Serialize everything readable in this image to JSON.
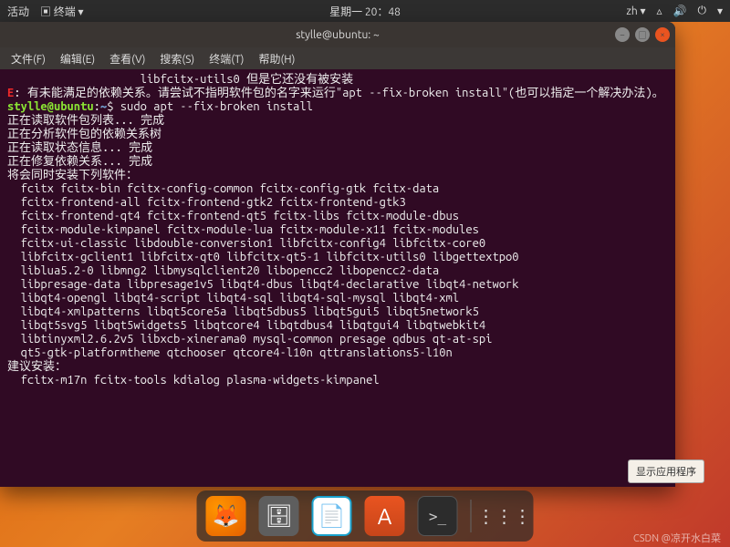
{
  "topbar": {
    "activities": "活动",
    "app": "终端",
    "datetime": "星期一  20：48",
    "lang": "zh"
  },
  "window": {
    "title": "stylle@ubuntu: ~"
  },
  "menubar": {
    "file": "文件(F)",
    "edit": "编辑(E)",
    "view": "查看(V)",
    "search": "搜索(S)",
    "terminal": "终端(T)",
    "help": "帮助(H)"
  },
  "terminal": {
    "l0": "                    libfcitx-utils0 但是它还没有被安装",
    "l1a": "E",
    "l1b": ": 有未能满足的依赖关系。请尝试不指明软件包的名字来运行\"apt --fix-broken install\"(也可以指定一个解决办法)。",
    "prompt_user": "stylle@ubuntu",
    "prompt_path": "~",
    "prompt_sep": ":",
    "prompt_dollar": "$ ",
    "cmd": "sudo apt --fix-broken install",
    "l3": "正在读取软件包列表... 完成",
    "l4": "正在分析软件包的依赖关系树",
    "l5": "正在读取状态信息... 完成",
    "l6": "正在修复依赖关系... 完成",
    "l7": "将会同时安装下列软件：",
    "p0": "  fcitx fcitx-bin fcitx-config-common fcitx-config-gtk fcitx-data",
    "p1": "  fcitx-frontend-all fcitx-frontend-gtk2 fcitx-frontend-gtk3",
    "p2": "  fcitx-frontend-qt4 fcitx-frontend-qt5 fcitx-libs fcitx-module-dbus",
    "p3": "  fcitx-module-kimpanel fcitx-module-lua fcitx-module-x11 fcitx-modules",
    "p4": "  fcitx-ui-classic libdouble-conversion1 libfcitx-config4 libfcitx-core0",
    "p5": "  libfcitx-gclient1 libfcitx-qt0 libfcitx-qt5-1 libfcitx-utils0 libgettextpo0",
    "p6": "  liblua5.2-0 libmng2 libmysqlclient20 libopencc2 libopencc2-data",
    "p7": "  libpresage-data libpresage1v5 libqt4-dbus libqt4-declarative libqt4-network",
    "p8": "  libqt4-opengl libqt4-script libqt4-sql libqt4-sql-mysql libqt4-xml",
    "p9": "  libqt4-xmlpatterns libqt5core5a libqt5dbus5 libqt5gui5 libqt5network5",
    "p10": "  libqt5svg5 libqt5widgets5 libqtcore4 libqtdbus4 libqtgui4 libqtwebkit4",
    "p11": "  libtinyxml2.6.2v5 libxcb-xinerama0 mysql-common presage qdbus qt-at-spi",
    "p12": "  qt5-gtk-platformtheme qtchooser qtcore4-l10n qttranslations5-l10n",
    "l8": "建议安装：",
    "s0": "  fcitx-m17n fcitx-tools kdialog plasma-widgets-kimpanel"
  },
  "tooltip": "显示应用程序",
  "watermark": "CSDN @凉开水白菜"
}
